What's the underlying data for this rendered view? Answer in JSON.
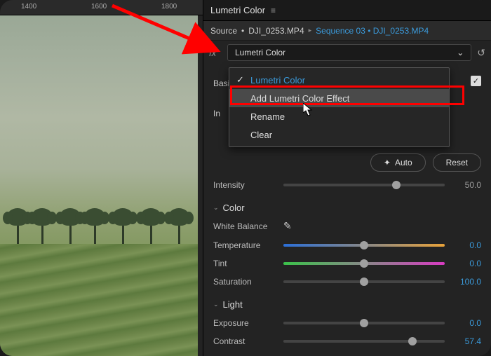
{
  "panel": {
    "title": "Lumetri Color",
    "source_label": "Source",
    "source_file": "DJI_0253.MP4",
    "breadcrumb": "Sequence 03 • DJI_0253.MP4",
    "fx_label": "fx",
    "dropdown_current": "Lumetri Color"
  },
  "dropdown": {
    "items": [
      "Lumetri Color",
      "Add Lumetri Color Effect",
      "Rename",
      "Clear"
    ]
  },
  "ruler": {
    "marks": [
      "1400",
      "1600",
      "1800"
    ]
  },
  "sections": {
    "basic_short": "Basi",
    "input_short": "In",
    "color": "Color",
    "white_balance": "White Balance",
    "light": "Light"
  },
  "buttons": {
    "auto": "Auto",
    "reset": "Reset"
  },
  "sliders": {
    "intensity": {
      "label": "Intensity",
      "value": "50.0",
      "pos": 70
    },
    "temperature": {
      "label": "Temperature",
      "value": "0.0",
      "pos": 50
    },
    "tint": {
      "label": "Tint",
      "value": "0.0",
      "pos": 50
    },
    "saturation": {
      "label": "Saturation",
      "value": "100.0",
      "pos": 50
    },
    "exposure": {
      "label": "Exposure",
      "value": "0.0",
      "pos": 50
    },
    "contrast": {
      "label": "Contrast",
      "value": "57.4",
      "pos": 80
    }
  }
}
